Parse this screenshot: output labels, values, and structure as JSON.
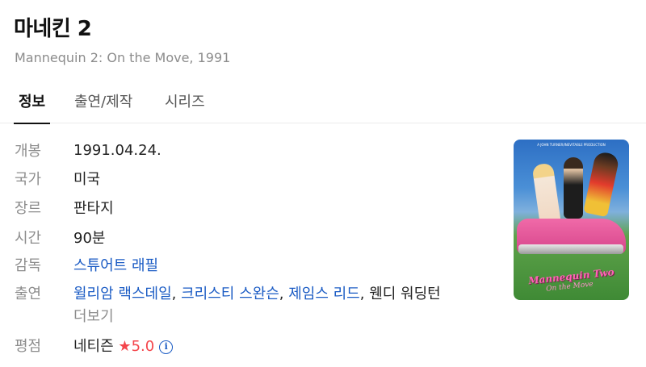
{
  "movie": {
    "title": "마네킨 2",
    "subtitle": "Mannequin 2: On the Move, 1991"
  },
  "tabs": [
    {
      "label": "정보",
      "active": true
    },
    {
      "label": "출연/제작",
      "active": false
    },
    {
      "label": "시리즈",
      "active": false
    }
  ],
  "info": {
    "release": {
      "label": "개봉",
      "value": "1991.04.24."
    },
    "country": {
      "label": "국가",
      "value": "미국"
    },
    "genre": {
      "label": "장르",
      "value": "판타지"
    },
    "runtime": {
      "label": "시간",
      "value": "90분"
    },
    "director": {
      "label": "감독",
      "value": "스튜어트 래필"
    },
    "cast": {
      "label": "출연",
      "names": [
        "윌리암 랙스데일",
        "크리스티 스완슨",
        "제임스 리드",
        "웬디 워딩턴"
      ],
      "separator": ", ",
      "more": "더보기"
    },
    "rating": {
      "label": "평점",
      "source": "네티즌",
      "star": "★",
      "score": "5.0",
      "info_glyph": "i"
    }
  },
  "poster": {
    "tagline": "A JOHN TURNER/INEVITABLE PRODUCTION",
    "logo_line1": "Mannequin Two",
    "logo_line2": "On the Move"
  },
  "colors": {
    "link": "#1a5bc4",
    "rating": "#f4464c",
    "label": "#8c8c8c"
  }
}
